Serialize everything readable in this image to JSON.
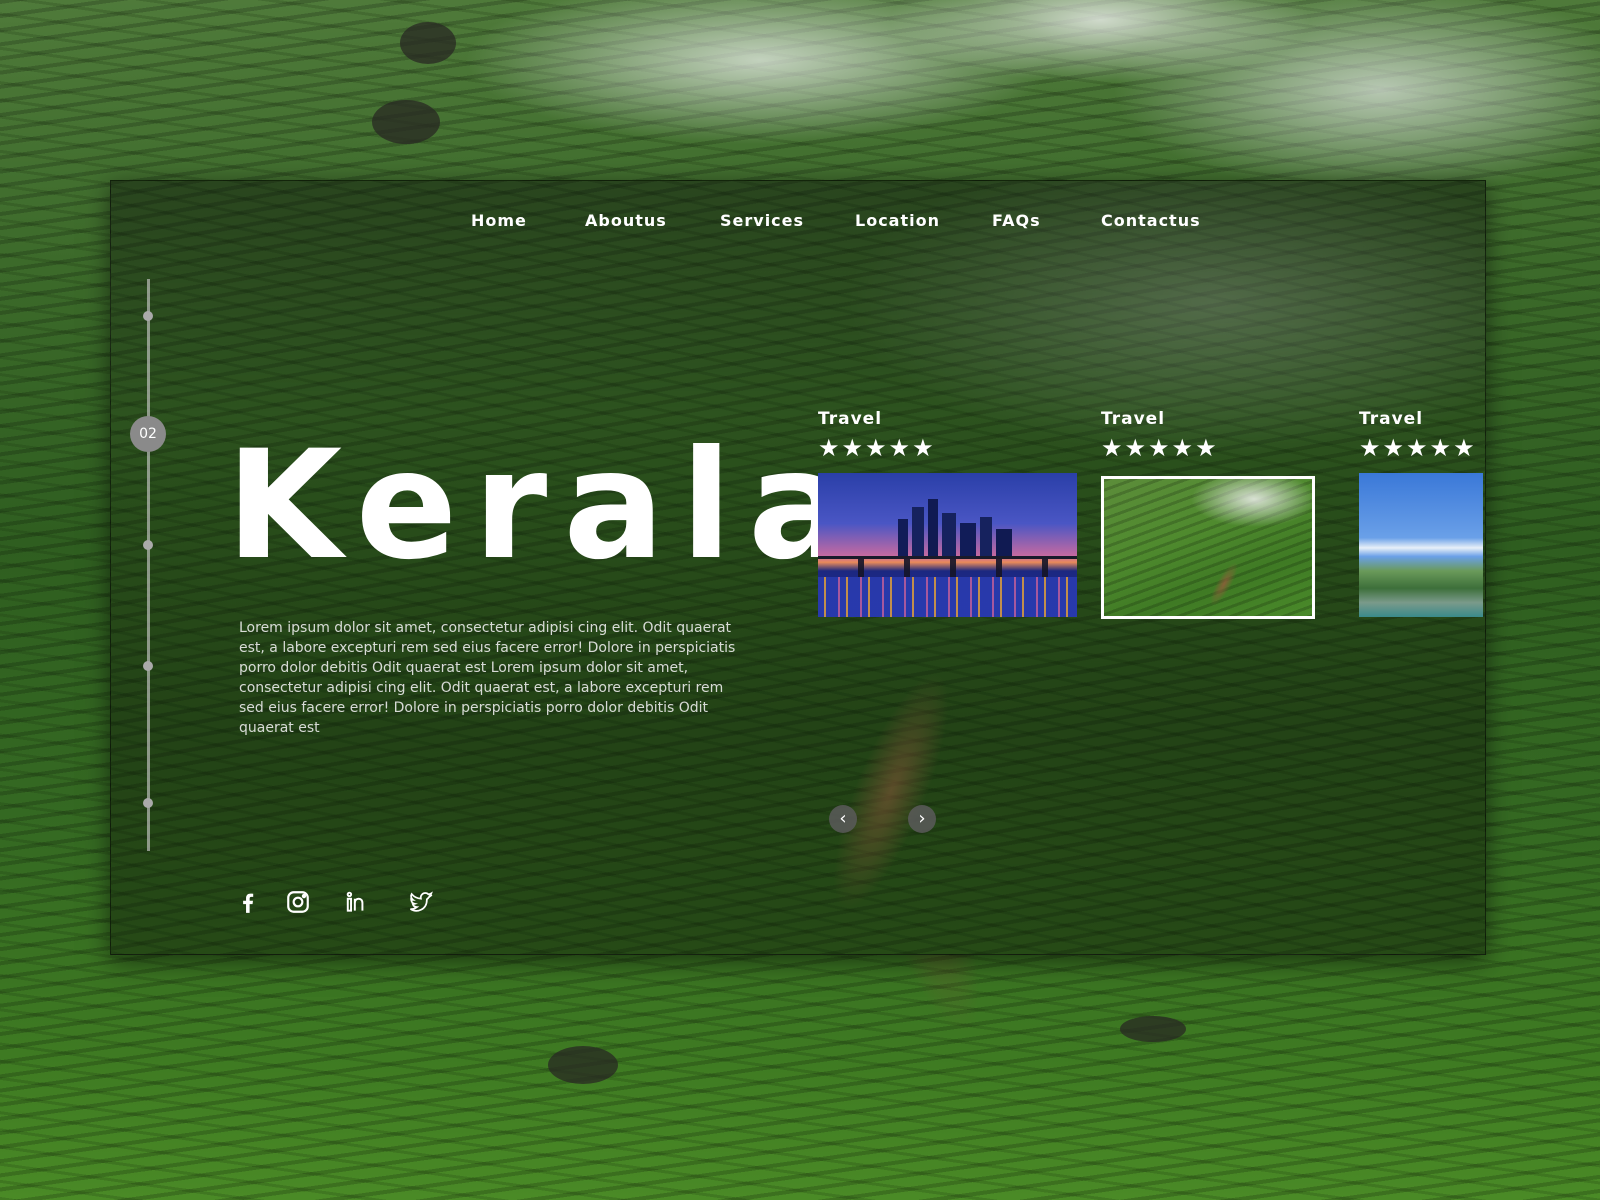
{
  "nav": {
    "items": [
      {
        "label": "Home"
      },
      {
        "label": "Aboutus"
      },
      {
        "label": "Services"
      },
      {
        "label": "Location"
      },
      {
        "label": "FAQs"
      },
      {
        "label": "Contactus"
      }
    ]
  },
  "timeline": {
    "active_label": "02"
  },
  "hero": {
    "title": "Kerala",
    "description": "Lorem ipsum dolor sit amet, consectetur adipisi cing elit. Odit quaerat est, a labore excepturi rem sed eius facere error! Dolore in perspiciatis porro dolor debitis Odit quaerat est  Lorem ipsum dolor sit amet, consectetur adipisi cing elit. Odit quaerat est, a labore excepturi rem sed eius facere error! Dolore in perspiciatis porro dolor debitis Odit quaerat est"
  },
  "cards": [
    {
      "label": "Travel",
      "stars": "★★★★★",
      "image": "city-bridge-night"
    },
    {
      "label": "Travel",
      "stars": "★★★★★",
      "image": "tea-plantation"
    },
    {
      "label": "Travel",
      "stars": "★★★★★",
      "image": "park-fountain"
    }
  ],
  "carousel": {
    "prev_icon": "chevron-left-icon",
    "next_icon": "chevron-right-icon",
    "prev_glyph": "‹",
    "next_glyph": "›"
  },
  "social": [
    "facebook-icon",
    "instagram-icon",
    "linkedin-icon",
    "twitter-icon"
  ]
}
